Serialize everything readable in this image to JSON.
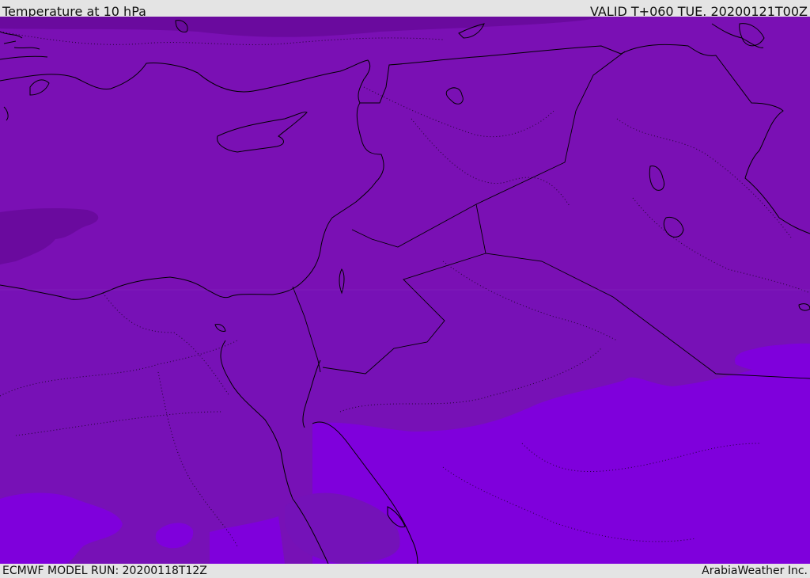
{
  "header": {
    "title": "Temperature at 10 hPa",
    "valid": "VALID T+060 TUE. 20200121T00Z"
  },
  "footer": {
    "model_run": "ECMWF MODEL RUN: 20200118T12Z",
    "credit": "ArabiaWeather Inc."
  },
  "colors": {
    "band_main": "#7a10b4",
    "band_cold": "#6a0a9e",
    "band_mid": "#7412b8",
    "band_warm": "#7f00dc",
    "coastline": "#000000"
  }
}
